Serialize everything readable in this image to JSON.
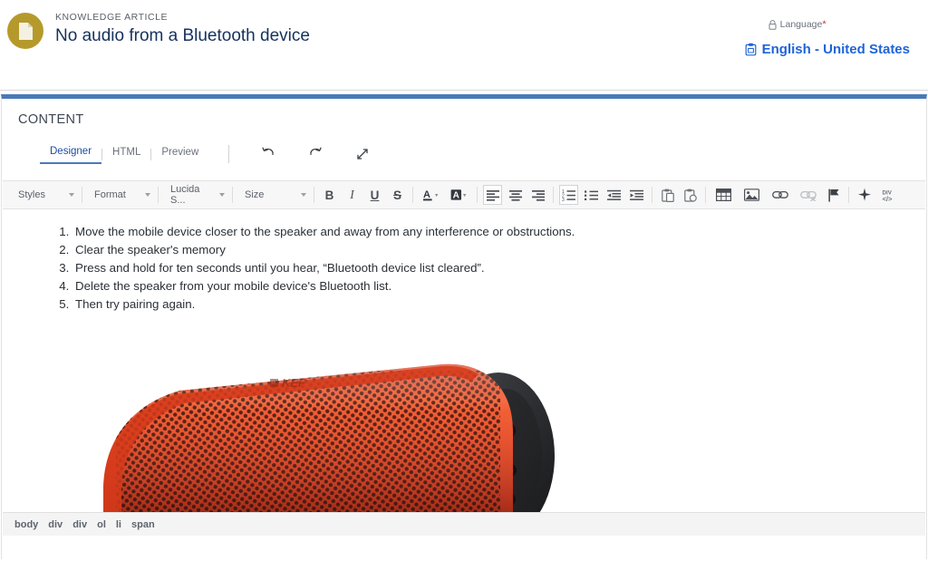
{
  "header": {
    "record_type": "KNOWLEDGE ARTICLE",
    "title": "No audio from a Bluetooth device",
    "avatar_icon": "document-icon",
    "language_label": "Language",
    "required_marker": "*",
    "lock_icon": "lock-icon",
    "language_value": "English - United States",
    "language_icon": "clipboard-icon"
  },
  "content_section": {
    "label": "CONTENT",
    "accent_color": "#4a7ab8",
    "tabs": [
      {
        "label": "Designer",
        "active": true
      },
      {
        "label": "HTML",
        "active": false
      },
      {
        "label": "Preview",
        "active": false
      }
    ],
    "actions": [
      {
        "name": "undo-icon",
        "title": "Undo"
      },
      {
        "name": "redo-icon",
        "title": "Redo"
      },
      {
        "name": "expand-icon",
        "title": "Expand"
      }
    ]
  },
  "toolbar": {
    "selects": [
      {
        "label": "Styles",
        "name": "styles-select"
      },
      {
        "label": "Format",
        "name": "format-select"
      },
      {
        "label": "Lucida S...",
        "name": "font-family-select"
      },
      {
        "label": "Size",
        "name": "font-size-select"
      }
    ],
    "buttons": [
      {
        "name": "bold-button",
        "glyph": "B",
        "active": false,
        "disabled": false
      },
      {
        "name": "italic-button",
        "glyph": "I",
        "active": false,
        "disabled": false
      },
      {
        "name": "underline-button",
        "glyph": "U",
        "active": false,
        "disabled": false
      },
      {
        "name": "strikethrough-button",
        "glyph": "S",
        "active": false,
        "disabled": false
      },
      {
        "name": "text-color-button",
        "glyph": "A",
        "active": false,
        "disabled": false
      },
      {
        "name": "background-color-button",
        "glyph": "A",
        "active": false,
        "disabled": false
      },
      {
        "name": "align-left-button",
        "active": true,
        "disabled": false
      },
      {
        "name": "align-center-button",
        "active": false,
        "disabled": false
      },
      {
        "name": "align-right-button",
        "active": false,
        "disabled": false
      },
      {
        "name": "numbered-list-button",
        "active": true,
        "disabled": false
      },
      {
        "name": "bulleted-list-button",
        "active": false,
        "disabled": false
      },
      {
        "name": "outdent-button",
        "active": false,
        "disabled": false
      },
      {
        "name": "indent-button",
        "active": false,
        "disabled": false
      },
      {
        "name": "paste-button",
        "active": false,
        "disabled": false
      },
      {
        "name": "paste-special-button",
        "active": false,
        "disabled": false
      },
      {
        "name": "insert-table-button",
        "active": false,
        "disabled": false
      },
      {
        "name": "insert-image-button",
        "active": false,
        "disabled": false
      },
      {
        "name": "insert-link-button",
        "active": false,
        "disabled": false
      },
      {
        "name": "remove-link-button",
        "active": false,
        "disabled": true
      },
      {
        "name": "anchor-button",
        "active": false,
        "disabled": false
      },
      {
        "name": "clean-formatting-button",
        "active": false,
        "disabled": false
      },
      {
        "name": "source-code-button",
        "active": false,
        "disabled": false
      }
    ]
  },
  "article_body": {
    "list_type": "ordered",
    "steps": [
      "Move the mobile device closer to the speaker and away from any interference or obstructions.",
      "Clear the speaker's memory",
      "Press and hold for ten seconds until you hear, “Bluetooth device list cleared”.",
      "Delete the speaker from your mobile device's Bluetooth list.",
      "Then try pairing again."
    ],
    "image": {
      "name": "bluetooth-speaker-image",
      "alt": "Red KEF cylindrical Bluetooth speaker",
      "brand_text": "KEF",
      "body_color": "#e0401f",
      "endcap_color": "#2c2c2e"
    }
  },
  "status_bar": {
    "element_path": [
      "body",
      "div",
      "div",
      "ol",
      "li",
      "span"
    ]
  }
}
